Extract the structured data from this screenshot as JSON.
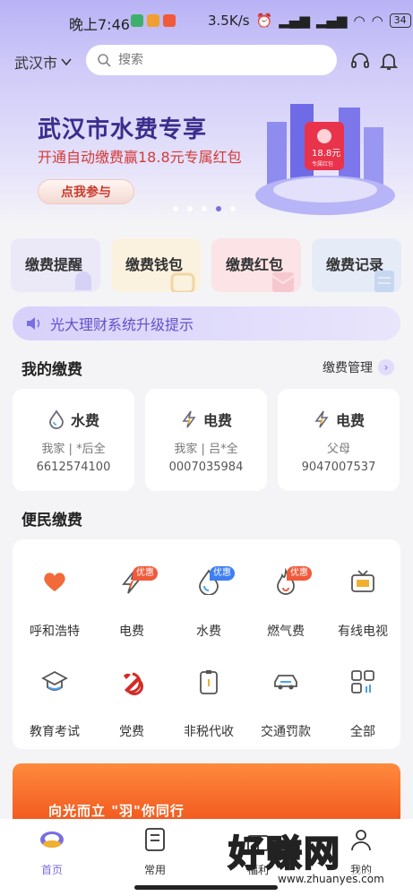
{
  "status_bar": {
    "time": "晚上7:46",
    "speed": "3.5K/s",
    "battery": "34"
  },
  "header": {
    "city": "武汉市",
    "search_placeholder": "搜索"
  },
  "banner": {
    "title": "武汉市水费专享",
    "subtitle": "开通自动缴费赢18.8元专属红包",
    "button": "点我参与",
    "badge_amount": "18.8元",
    "badge_label": "专属红包",
    "dots": 5,
    "active_dot": 4
  },
  "quick_actions": [
    {
      "label": "缴费提醒",
      "icon": "bell-icon",
      "bg": "#ebe8f8"
    },
    {
      "label": "缴费钱包",
      "icon": "wallet-icon",
      "bg": "#fbf1df"
    },
    {
      "label": "缴费红包",
      "icon": "red-envelope-icon",
      "bg": "#fbe3e6"
    },
    {
      "label": "缴费记录",
      "icon": "record-icon",
      "bg": "#e5ecf8"
    }
  ],
  "notice": "光大理财系统升级提示",
  "my_bills": {
    "title": "我的缴费",
    "manage": "缴费管理",
    "cards": [
      {
        "type": "水费",
        "icon": "water-drop-icon",
        "owner": "我家 | *后全",
        "account": "6612574100"
      },
      {
        "type": "电费",
        "icon": "lightning-icon",
        "owner": "我家 | 吕*全",
        "account": "0007035984"
      },
      {
        "type": "电费",
        "icon": "lightning-icon",
        "owner": "父母",
        "account": "9047007537"
      }
    ]
  },
  "services": {
    "title": "便民缴费",
    "items": [
      {
        "label": "呼和浩特",
        "icon": "heart-icon",
        "badge": ""
      },
      {
        "label": "电费",
        "icon": "lightning-icon",
        "badge": "优惠"
      },
      {
        "label": "水费",
        "icon": "water-drop-icon",
        "badge": "优惠"
      },
      {
        "label": "燃气费",
        "icon": "flame-icon",
        "badge": "优惠"
      },
      {
        "label": "有线电视",
        "icon": "tv-icon",
        "badge": ""
      },
      {
        "label": "教育考试",
        "icon": "graduation-cap-icon",
        "badge": ""
      },
      {
        "label": "党费",
        "icon": "party-emblem-icon",
        "badge": ""
      },
      {
        "label": "非税代收",
        "icon": "document-icon",
        "badge": ""
      },
      {
        "label": "交通罚款",
        "icon": "car-icon",
        "badge": ""
      },
      {
        "label": "全部",
        "icon": "grid-icon",
        "badge": ""
      }
    ]
  },
  "promo": {
    "text": "向光而立 \"羽\"你同行"
  },
  "tabbar": [
    {
      "label": "首页",
      "icon": "home-icon",
      "active": true
    },
    {
      "label": "常用",
      "icon": "note-icon",
      "active": false
    },
    {
      "label": "福利",
      "icon": "gift-icon",
      "active": false
    },
    {
      "label": "我的",
      "icon": "user-icon",
      "active": false
    }
  ],
  "watermark": {
    "big": "好赚网",
    "small": "www.zhuanyes.com"
  },
  "colors": {
    "accent": "#7a6fe0",
    "banner_title": "#3a2d8c",
    "red": "#d43a36",
    "orange": "#f25a1f"
  }
}
